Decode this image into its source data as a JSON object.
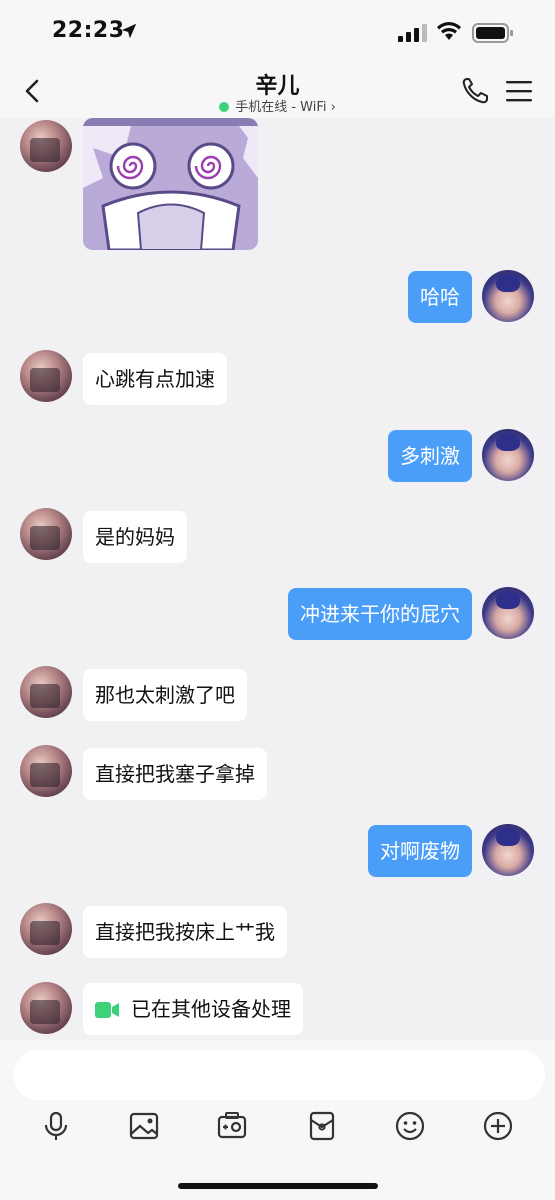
{
  "status_bar": {
    "time": "22:23"
  },
  "header": {
    "title": "辛儿",
    "subtitle": "手机在线 - WiFi",
    "subtitle_arrow": "›"
  },
  "messages": [
    {
      "side": "left",
      "type": "sticker",
      "text": ""
    },
    {
      "side": "right",
      "type": "text",
      "text": "哈哈"
    },
    {
      "side": "left",
      "type": "text",
      "text": "心跳有点加速"
    },
    {
      "side": "right",
      "type": "text",
      "text": "多刺激"
    },
    {
      "side": "left",
      "type": "text",
      "text": "是的妈妈"
    },
    {
      "side": "right",
      "type": "text",
      "text": "冲进来干你的屁穴"
    },
    {
      "side": "left",
      "type": "text",
      "text": "那也太刺激了吧"
    },
    {
      "side": "left",
      "type": "text",
      "text": "直接把我塞子拿掉"
    },
    {
      "side": "right",
      "type": "text",
      "text": "对啊废物"
    },
    {
      "side": "left",
      "type": "text",
      "text": "直接把我按床上艹我"
    },
    {
      "side": "left",
      "type": "video_call",
      "text": "已在其他设备处理"
    }
  ],
  "input": {
    "placeholder": ""
  },
  "toolbar": [
    "microphone-icon",
    "image-icon",
    "camera-icon",
    "red-packet-icon",
    "emoji-icon",
    "plus-icon"
  ],
  "colors": {
    "bubble_right": "#4a9ef8",
    "bubble_left": "#ffffff",
    "background": "#f1f1f3",
    "online_dot": "#3fd07a",
    "video_icon": "#3fd07a"
  }
}
